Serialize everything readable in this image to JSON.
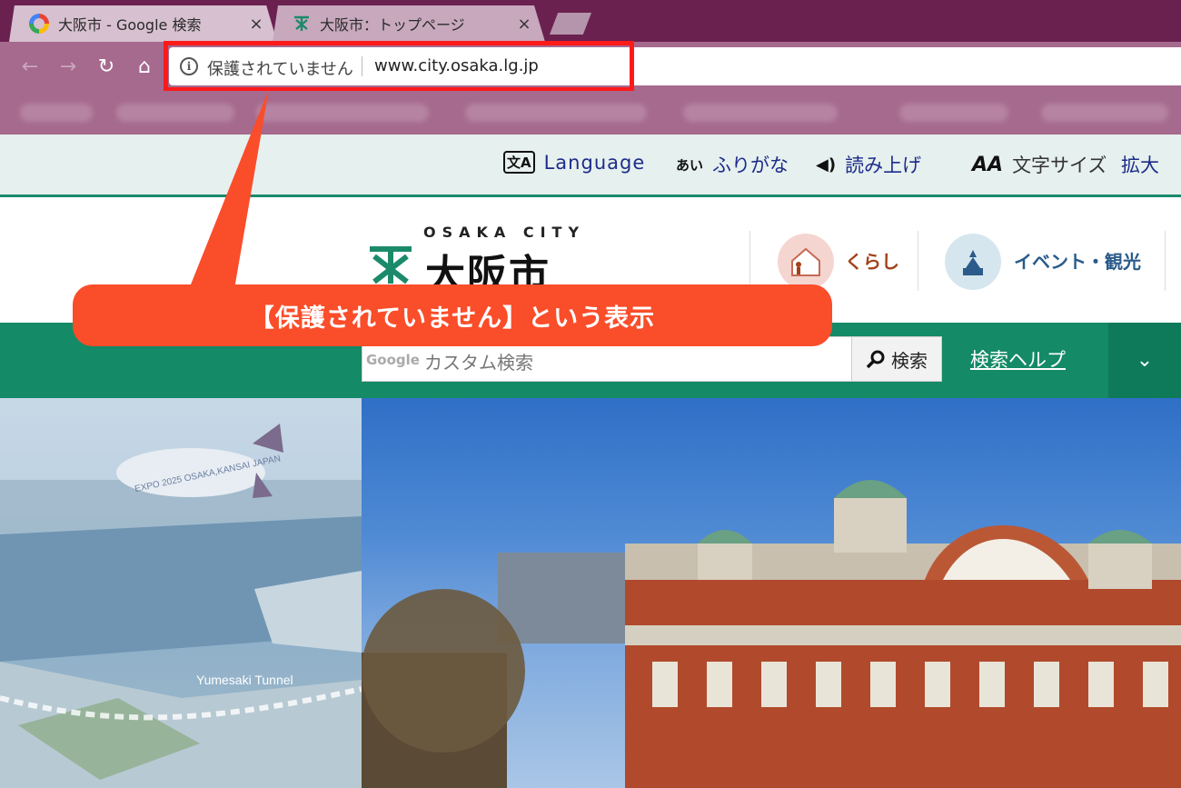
{
  "browser": {
    "tabs": [
      {
        "title": "大阪市 - Google 検索",
        "close": "×",
        "favicon": "google-icon"
      },
      {
        "title": "大阪市：トップページ",
        "close": "×",
        "favicon": "osaka-city-icon"
      }
    ],
    "security_text": "保護されていません",
    "url": "www.city.osaka.lg.jp",
    "nav": {
      "back": "←",
      "forward": "→",
      "reload": "↻",
      "home": "⌂"
    }
  },
  "annotation": {
    "callout_text": "【保護されていません】という表示",
    "color": "#fa4d2a",
    "box_color": "#ff1a1a"
  },
  "utility": {
    "items": [
      {
        "icon": "translate-icon",
        "glyph": "文A",
        "label": "Language"
      },
      {
        "icon": "furigana-icon",
        "glyph": "あい",
        "label": "ふりがな"
      },
      {
        "icon": "speaker-icon",
        "glyph": "◀)",
        "label": "読み上げ"
      },
      {
        "icon": "font-size-icon",
        "glyph": "AA",
        "label": "文字サイズ"
      },
      {
        "label": "拡大"
      }
    ]
  },
  "header": {
    "logo_en": "OSAKA CITY",
    "logo_jp": "大阪市",
    "categories": [
      {
        "label": "くらし",
        "color": "#a3411a",
        "circle": "#f4d5cf"
      },
      {
        "label": "イベント・観光",
        "color": "#2a5b8a",
        "circle": "#d6e6ee"
      }
    ]
  },
  "search": {
    "google_label": "Google",
    "placeholder": "カスタム検索",
    "button": "検索",
    "help": "検索ヘルプ",
    "expand": "⌄",
    "bar_color": "#148a66"
  },
  "hero": {
    "left_caption": "Yumesaki Tunnel",
    "blimp_text": "EXPO 2025 OSAKA,KANSAI JAPAN"
  }
}
